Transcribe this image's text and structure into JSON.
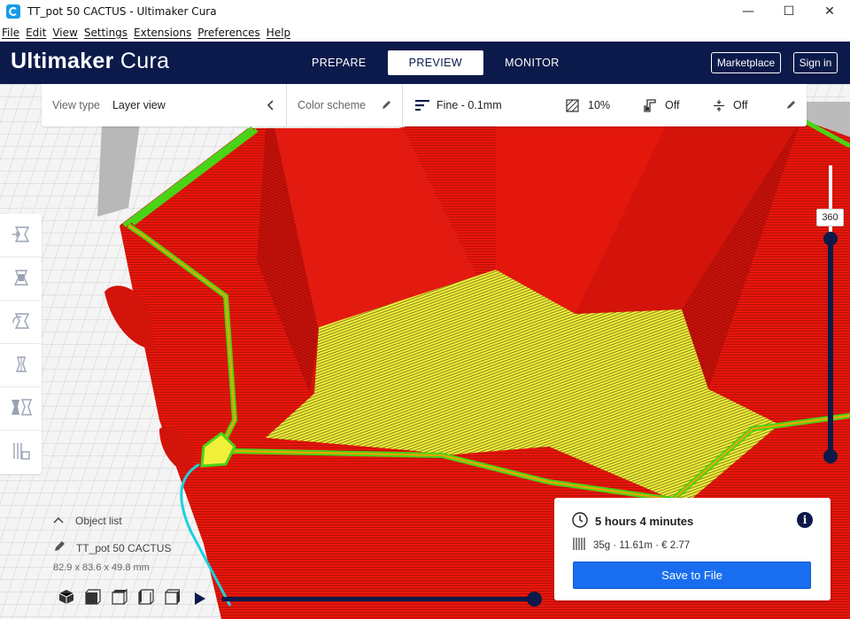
{
  "window": {
    "title": "TT_pot 50 CACTUS - Ultimaker Cura",
    "minimize": "—",
    "maximize": "☐",
    "close": "✕"
  },
  "menu": {
    "items": [
      "File",
      "Edit",
      "View",
      "Settings",
      "Extensions",
      "Preferences",
      "Help"
    ]
  },
  "header": {
    "logo_bold": "Ultimaker",
    "logo_light": "Cura",
    "tabs": [
      {
        "label": "PREPARE",
        "active": false
      },
      {
        "label": "PREVIEW",
        "active": true
      },
      {
        "label": "MONITOR",
        "active": false
      }
    ],
    "marketplace_label": "Marketplace",
    "signin_label": "Sign in"
  },
  "view_toolbar": {
    "view_type_label": "View type",
    "view_type_value": "Layer view",
    "color_scheme_label": "Color scheme",
    "profile": "Fine - 0.1mm",
    "infill": "10%",
    "support": "Off",
    "adhesion": "Off"
  },
  "left_tools": [
    "move-tool",
    "scale-tool",
    "rotate-tool",
    "mirror-tool",
    "per-model-settings-tool",
    "support-blocker-tool"
  ],
  "object": {
    "list_label": "Object list",
    "name": "TT_pot 50 CACTUS",
    "dimensions": "82.9 x 83.6 x 49.8 mm"
  },
  "layer_slider": {
    "current_layer": "360",
    "fraction": 1.0
  },
  "simulation": {
    "play_icon": "play-icon"
  },
  "print_info": {
    "time": "5 hours 4 minutes",
    "material": "35g · 11.61m · € 2.77",
    "save_label": "Save to File",
    "info_symbol": "i"
  },
  "colors": {
    "header_bg": "#0b1a4a",
    "accent_blue": "#196ef0",
    "wall_red": "#e8160c",
    "infill_yellow": "#f2ef3a",
    "inner_wall_green": "#4ad417",
    "travel_cyan": "#19d2e0"
  }
}
